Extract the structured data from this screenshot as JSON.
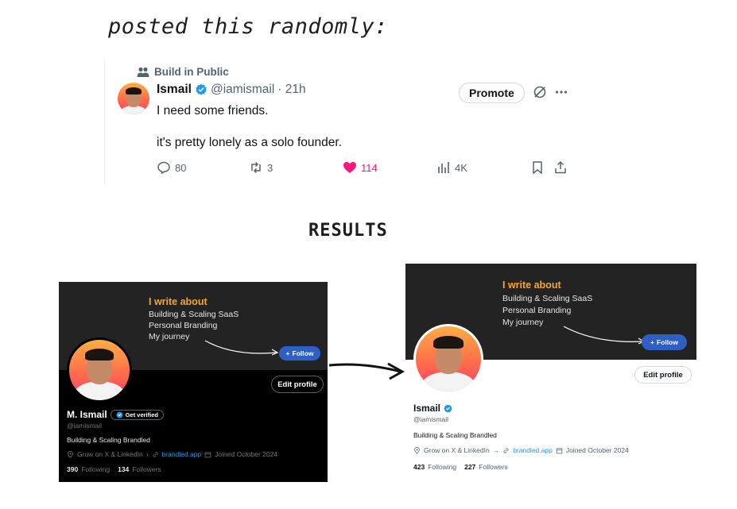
{
  "caption": "posted  this randomly:",
  "results_heading": "RESULTS",
  "tweet": {
    "community": "Build in Public",
    "name": "Ismail",
    "handle": "@iamismail",
    "time": "· 21h",
    "promote_label": "Promote",
    "line1": "I need some friends.",
    "line2": "it's pretty lonely as a solo founder.",
    "replies": "80",
    "reposts": "3",
    "likes": "114",
    "views": "4K",
    "like_color": "#f91880"
  },
  "profile_before": {
    "banner_title": "I write about",
    "banner_lines": [
      "Building & Scaling SaaS",
      "Personal Branding",
      "My journey"
    ],
    "follow_label": "Follow",
    "edit_label": "Edit profile",
    "name": "M. Ismail",
    "get_verified": "Get verified",
    "handle": "@iamismail",
    "bio": "Building & Scaling Brandled",
    "location": "Grow on X & LinkedIn",
    "link": "brandled.app",
    "joined": "Joined October 2024",
    "following_count": "390",
    "following_label": "Following",
    "followers_count": "134",
    "followers_label": "Followers"
  },
  "profile_after": {
    "banner_title": "I write about",
    "banner_lines": [
      "Building & Scaling SaaS",
      "Personal Branding",
      "My journey"
    ],
    "follow_label": "Follow",
    "edit_label": "Edit profile",
    "name": "Ismail",
    "handle": "@iamismail",
    "bio": "Building & Scaling Brandled",
    "location": "Grow on X & LinkedIn",
    "link": "brandled.app",
    "joined": "Joined October 2024",
    "following_count": "423",
    "following_label": "Following",
    "followers_count": "227",
    "followers_label": "Followers"
  },
  "colors": {
    "accent_blue": "#1d9bf0",
    "banner_orange": "#f7a530",
    "follow_blue": "#2f5fc4"
  }
}
